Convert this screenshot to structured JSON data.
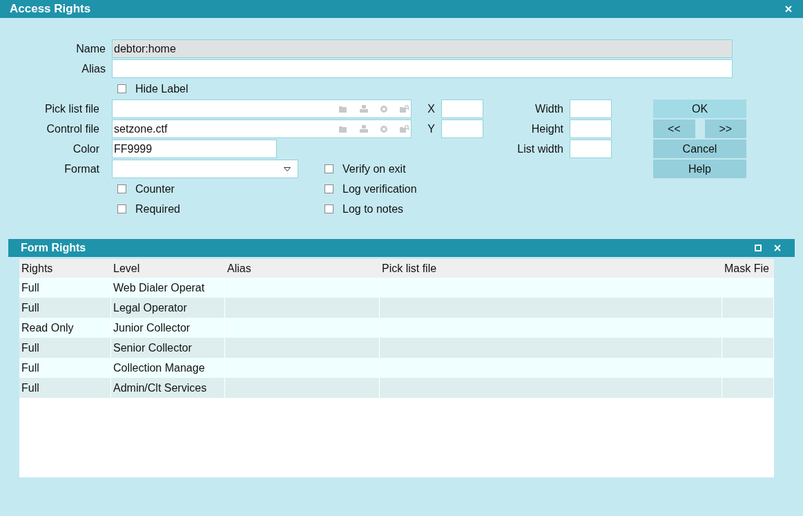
{
  "window": {
    "title": "Access Rights"
  },
  "form": {
    "name": {
      "label": "Name",
      "value": "debtor:home",
      "readonly": true
    },
    "alias": {
      "label": "Alias",
      "readonly": false
    },
    "hide_label": {
      "label": "Hide Label",
      "checked": false
    },
    "file_fields": [
      {
        "label": "Pick list file"
      },
      {
        "label": "Control file",
        "value": "setzone.ctf"
      }
    ],
    "position": [
      {
        "label": "X"
      },
      {
        "label": "Y"
      }
    ],
    "size": [
      {
        "label": "Width"
      },
      {
        "label": "Height"
      },
      {
        "label": "List width"
      }
    ],
    "color": {
      "label": "Color",
      "value": "FF9999"
    },
    "format": {
      "label": "Format"
    },
    "left_checks": [
      {
        "label": "Counter",
        "checked": false
      },
      {
        "label": "Required",
        "checked": false
      }
    ],
    "right_checks": [
      {
        "label": "Verify on exit",
        "checked": false
      },
      {
        "label": "Log verification",
        "checked": false
      },
      {
        "label": "Log to notes",
        "checked": false
      }
    ]
  },
  "buttons": [
    {
      "label": "OK",
      "kind": "default"
    },
    {
      "label": "<<",
      "kind": "half"
    },
    {
      "label": ">>",
      "kind": "half"
    },
    {
      "label": "Cancel",
      "kind": "normal"
    },
    {
      "label": "Help",
      "kind": "normal"
    }
  ],
  "form_rights": {
    "title": "Form Rights",
    "columns": [
      "Rights",
      "Level",
      "Alias",
      "Pick list file",
      "Mask Fie"
    ],
    "rows": [
      [
        "Full",
        "Web Dialer Operat",
        null,
        null,
        null
      ],
      [
        "Full",
        "Legal Operator",
        null,
        null,
        null
      ],
      [
        "Read Only",
        "Junior Collector",
        null,
        null,
        null
      ],
      [
        "Full",
        "Senior Collector",
        null,
        null,
        null
      ],
      [
        "Full",
        "Collection Manage",
        null,
        null,
        null
      ],
      [
        "Full",
        "Admin/Clt Services",
        null,
        null,
        null
      ]
    ]
  }
}
